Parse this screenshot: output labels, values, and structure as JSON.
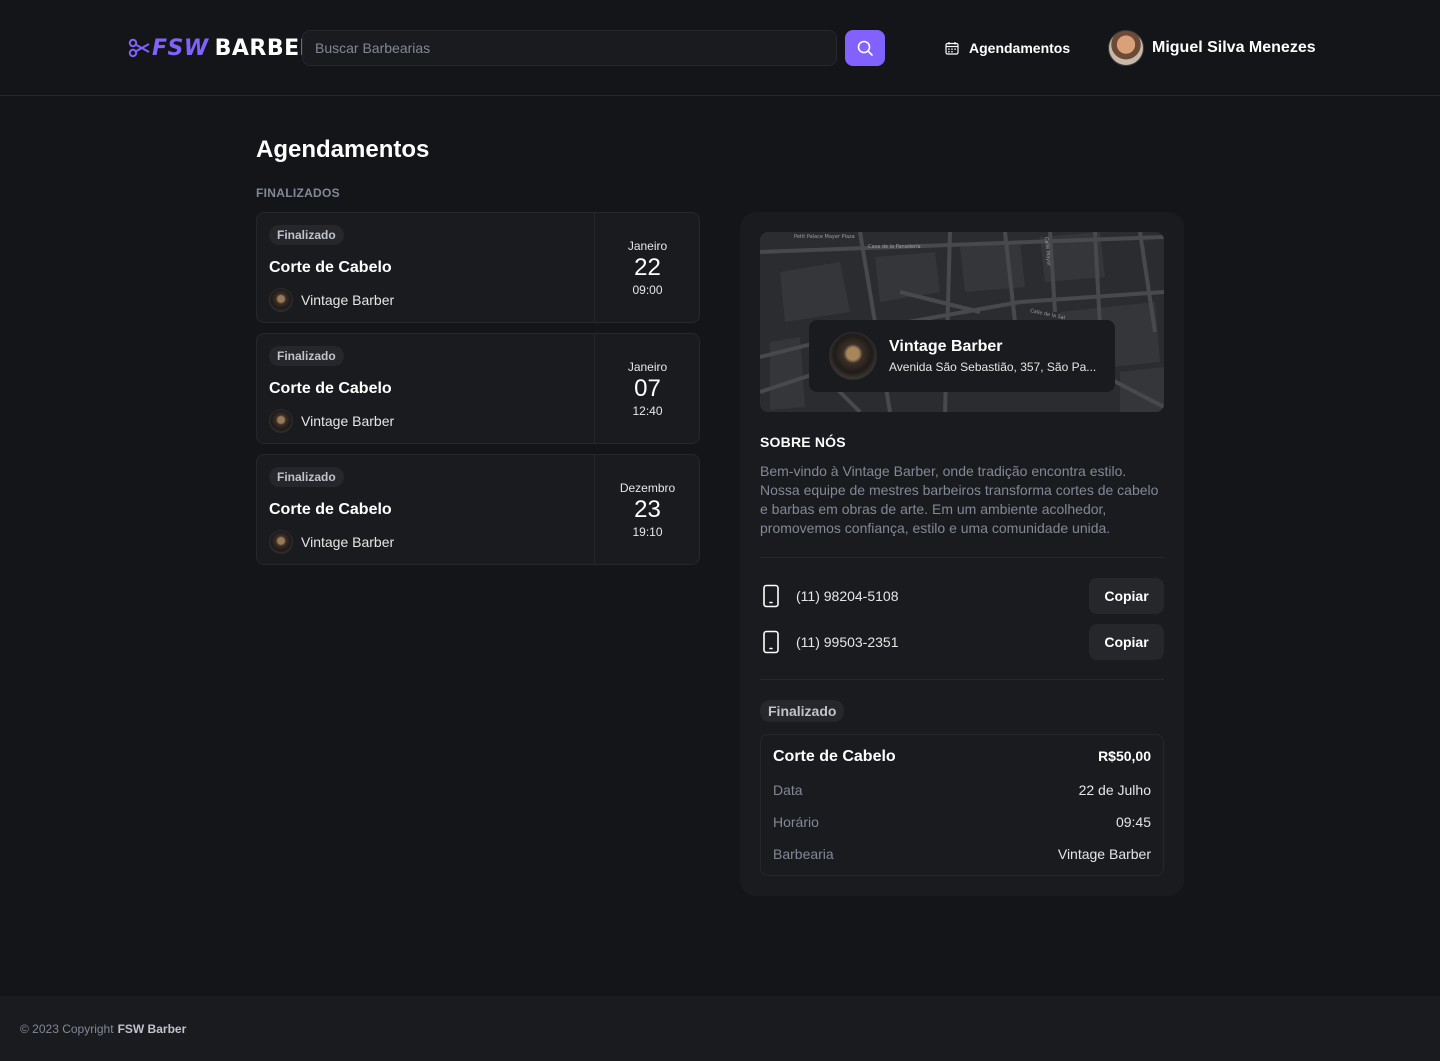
{
  "header": {
    "logo_accent": "FSW",
    "logo_main": "BARBER",
    "search_placeholder": "Buscar Barbearias",
    "nav_bookings": "Agendamentos",
    "user_name": "Miguel Silva Menezes"
  },
  "colors": {
    "accent": "#8162ff",
    "background": "#141518",
    "card": "#1a1b1f",
    "border": "#26272b",
    "muted": "#838896"
  },
  "main": {
    "title": "Agendamentos",
    "section_finished": "FINALIZADOS",
    "bookings": [
      {
        "status": "Finalizado",
        "service": "Corte de Cabelo",
        "barbershop": "Vintage Barber",
        "month": "Janeiro",
        "day": "22",
        "time": "09:00"
      },
      {
        "status": "Finalizado",
        "service": "Corte de Cabelo",
        "barbershop": "Vintage Barber",
        "month": "Janeiro",
        "day": "07",
        "time": "12:40"
      },
      {
        "status": "Finalizado",
        "service": "Corte de Cabelo",
        "barbershop": "Vintage Barber",
        "month": "Dezembro",
        "day": "23",
        "time": "19:10"
      }
    ]
  },
  "details": {
    "map_labels": [
      "Petit Palace Mayer Plaza",
      "Casa de la Panadería",
      "Calle de la Sal",
      "Calle Mayor"
    ],
    "shop_name": "Vintage Barber",
    "shop_address": "Avenida São Sebastião, 357, São Pa...",
    "about_title": "SOBRE NÓS",
    "about_text": "Bem-vindo à Vintage Barber, onde tradição encontra estilo. Nossa equipe de mestres barbeiros transforma cortes de cabelo e barbas em obras de arte. Em um ambiente acolhedor, promovemos confiança, estilo e uma comunidade unida.",
    "phones": [
      "(11) 98204-5108",
      "(11) 99503-2351"
    ],
    "copy_label": "Copiar",
    "status": "Finalizado",
    "summary": {
      "service": "Corte de Cabelo",
      "price": "R$50,00",
      "date_label": "Data",
      "date_value": "22 de Julho",
      "time_label": "Horário",
      "time_value": "09:45",
      "shop_label": "Barbearia",
      "shop_value": "Vintage Barber"
    }
  },
  "footer": {
    "copyright": "© 2023 Copyright",
    "brand": "FSW Barber"
  }
}
